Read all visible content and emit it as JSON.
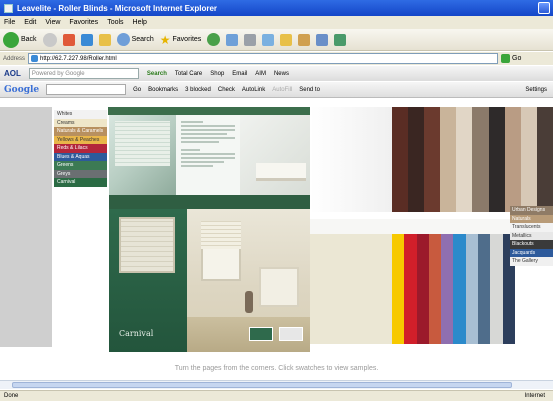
{
  "window": {
    "title": "Leavelite - Roller Blinds - Microsoft Internet Explorer"
  },
  "menubar": [
    "File",
    "Edit",
    "View",
    "Favorites",
    "Tools",
    "Help"
  ],
  "toolbar": {
    "back_label": "Back",
    "search_label": "Search",
    "favorites_label": "Favorites"
  },
  "address": {
    "label": "Address",
    "url": "http://62.7.227.98/Roller.html",
    "go_label": "Go"
  },
  "aolbar": {
    "logo": "AOL",
    "powered_by": "Powered by Google",
    "search_button": "Search",
    "items": [
      "Total Care",
      "Shop",
      "Email",
      "AIM",
      "News"
    ]
  },
  "googlebar": {
    "logo": "Google",
    "go": "Go",
    "bookmarks": "Bookmarks",
    "blocked": "3 blocked",
    "check": "Check",
    "autolink": "AutoLink",
    "autofill": "AutoFill",
    "sendto": "Send to",
    "settings": "Settings"
  },
  "book": {
    "nav_menu": [
      {
        "label": "Whites",
        "color": "#f2f2f2",
        "text": "#333333"
      },
      {
        "label": "Creams",
        "color": "#efe6c8",
        "text": "#333333"
      },
      {
        "label": "Naturals & Caramels",
        "color": "#b8905f",
        "text": "#ffffff"
      },
      {
        "label": "Yellows & Peaches",
        "color": "#e8b64a",
        "text": "#333333"
      },
      {
        "label": "Reds & Lilacs",
        "color": "#b3263b",
        "text": "#ffffff"
      },
      {
        "label": "Blues & Aquas",
        "color": "#2d5a9b",
        "text": "#ffffff"
      },
      {
        "label": "Greens",
        "color": "#3c7a54",
        "text": "#ffffff"
      },
      {
        "label": "Greys",
        "color": "#6b6f72",
        "text": "#ffffff"
      },
      {
        "label": "Carnival",
        "color": "#2b6b44",
        "text": "#ffffff"
      }
    ],
    "cover_title": "Carnival"
  },
  "category_menu": [
    {
      "label": "Urban Designs",
      "color": "#8f7b66",
      "text": "#ffffff"
    },
    {
      "label": "Naturals",
      "color": "#b89b78",
      "text": "#ffffff"
    },
    {
      "label": "Translucents",
      "color": "#f2f2f2",
      "text": "#333333"
    },
    {
      "label": "Metallics",
      "color": "#e8e8e8",
      "text": "#333333"
    },
    {
      "label": "Blackouts",
      "color": "#3a3a3a",
      "text": "#ffffff"
    },
    {
      "label": "Jacquards",
      "color": "#2d5a9b",
      "text": "#ffffff"
    },
    {
      "label": "The Gallery",
      "color": "#f0f0f0",
      "text": "#333333"
    }
  ],
  "swatches_top": [
    "#5a2d24",
    "#3a2622",
    "#6b3a2e",
    "#c9b49a",
    "#e1d6c6",
    "#8b7a6a",
    "#2e2a2a",
    "#b99c84",
    "#d7c8b6",
    "#4a3d37"
  ],
  "swatches_bottom": [
    "#f7c900",
    "#d11f2a",
    "#9b1a2b",
    "#c85a3e",
    "#8f6fb0",
    "#2b8acb",
    "#a8bfd3",
    "#4f6d8b",
    "#d7d8d6",
    "#2c3e5c"
  ],
  "instruction": "Turn the pages from the corners. Click swatches to view samples.",
  "status": {
    "left": "Done",
    "right": "Internet"
  }
}
